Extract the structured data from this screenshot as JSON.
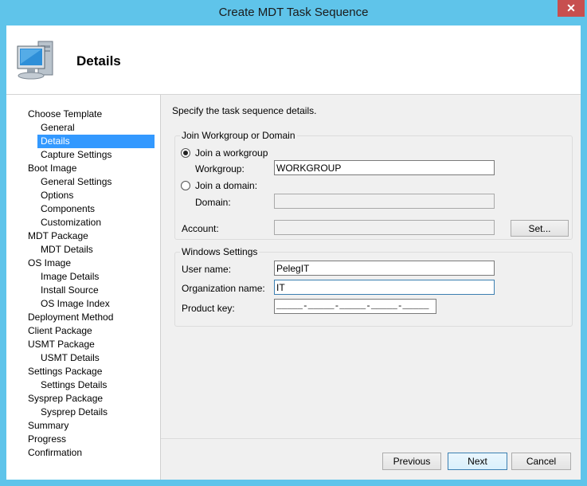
{
  "window": {
    "title": "Create MDT Task Sequence",
    "close_glyph": "✕"
  },
  "header": {
    "title": "Details",
    "icon": "computer-icon"
  },
  "sidebar": {
    "items": [
      {
        "label": "Choose Template",
        "level": 0
      },
      {
        "label": "General",
        "level": 1
      },
      {
        "label": "Details",
        "level": 1,
        "selected": true
      },
      {
        "label": "Capture Settings",
        "level": 1
      },
      {
        "label": "Boot Image",
        "level": 0
      },
      {
        "label": "General Settings",
        "level": 1
      },
      {
        "label": "Options",
        "level": 1
      },
      {
        "label": "Components",
        "level": 1
      },
      {
        "label": "Customization",
        "level": 1
      },
      {
        "label": "MDT Package",
        "level": 0
      },
      {
        "label": "MDT Details",
        "level": 1
      },
      {
        "label": "OS Image",
        "level": 0
      },
      {
        "label": "Image Details",
        "level": 1
      },
      {
        "label": "Install Source",
        "level": 1
      },
      {
        "label": "OS Image Index",
        "level": 1
      },
      {
        "label": "Deployment Method",
        "level": 0
      },
      {
        "label": "Client Package",
        "level": 0
      },
      {
        "label": "USMT Package",
        "level": 0
      },
      {
        "label": "USMT Details",
        "level": 1
      },
      {
        "label": "Settings Package",
        "level": 0
      },
      {
        "label": "Settings Details",
        "level": 1
      },
      {
        "label": "Sysprep Package",
        "level": 0
      },
      {
        "label": "Sysprep Details",
        "level": 1
      },
      {
        "label": "Summary",
        "level": 0
      },
      {
        "label": "Progress",
        "level": 0
      },
      {
        "label": "Confirmation",
        "level": 0
      }
    ]
  },
  "main": {
    "intro": "Specify the task sequence details.",
    "join_group": {
      "title": "Join Workgroup or Domain",
      "workgroup_radio": "Join a workgroup",
      "workgroup_label": "Workgroup:",
      "workgroup_value": "WORKGROUP",
      "domain_radio": "Join a domain:",
      "domain_label": "Domain:",
      "domain_value": "",
      "account_label": "Account:",
      "account_value": "",
      "set_button": "Set..."
    },
    "windows_group": {
      "title": "Windows Settings",
      "username_label": "User name:",
      "username_value": "PelegIT",
      "org_label": "Organization name:",
      "org_value": "IT",
      "product_key_label": "Product key:",
      "product_key_value": "_____-_____-_____-_____-_____"
    }
  },
  "footer": {
    "previous": "Previous",
    "next": "Next",
    "cancel": "Cancel"
  }
}
